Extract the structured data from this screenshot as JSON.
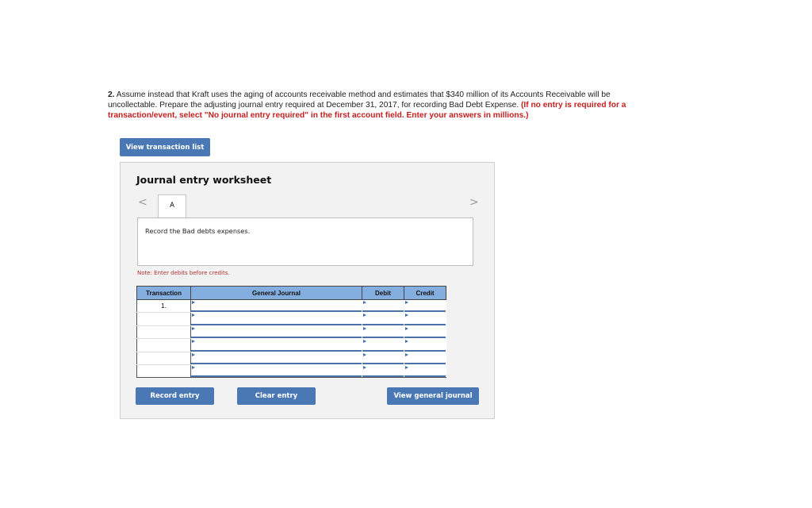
{
  "question": {
    "number": "2.",
    "text": " Assume instead that Kraft uses the aging of accounts receivable method and estimates that $340 million of its Accounts Receivable will be uncollectable. Prepare the adjusting journal entry required at December 31, 2017, for recording Bad Debt Expense. ",
    "instruction": "(If no entry is required for a transaction/event, select \"No journal entry required\" in the first account field. Enter your answers in millions.)"
  },
  "view_transaction_list_label": "View transaction list",
  "worksheet": {
    "title": "Journal entry worksheet",
    "prev_icon": "<",
    "next_icon": ">",
    "tab_label": "A",
    "description": "Record the Bad debts expenses.",
    "note": "Note: Enter debits before credits.",
    "columns": [
      "Transaction",
      "General Journal",
      "Debit",
      "Credit"
    ],
    "rows": [
      {
        "transaction": "1.",
        "account": "",
        "debit": "",
        "credit": ""
      },
      {
        "transaction": "",
        "account": "",
        "debit": "",
        "credit": ""
      },
      {
        "transaction": "",
        "account": "",
        "debit": "",
        "credit": ""
      },
      {
        "transaction": "",
        "account": "",
        "debit": "",
        "credit": ""
      },
      {
        "transaction": "",
        "account": "",
        "debit": "",
        "credit": ""
      },
      {
        "transaction": "",
        "account": "",
        "debit": "",
        "credit": ""
      }
    ],
    "buttons": {
      "record": "Record entry",
      "clear": "Clear entry",
      "view_journal": "View general journal"
    }
  }
}
